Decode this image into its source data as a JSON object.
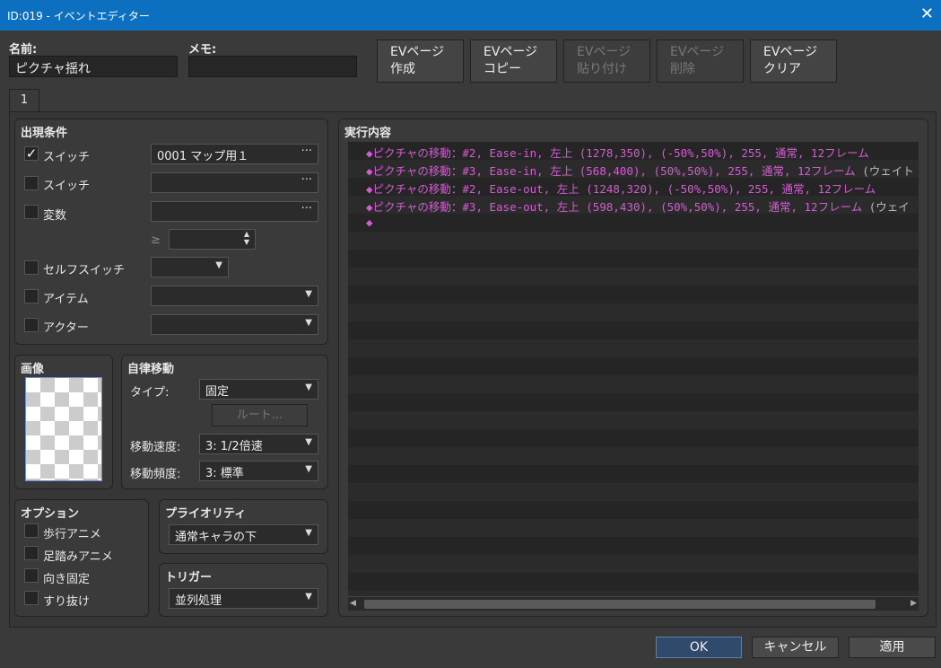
{
  "window": {
    "title": "ID:019 - イベントエディター",
    "close_icon": "close-icon"
  },
  "header": {
    "name_label": "名前:",
    "name_value": "ピクチャ揺れ",
    "memo_label": "メモ:",
    "memo_value": "",
    "buttons": [
      {
        "line1": "EVページ",
        "line2": "作成",
        "enabled": true
      },
      {
        "line1": "EVページ",
        "line2": "コピー",
        "enabled": true
      },
      {
        "line1": "EVページ",
        "line2": "貼り付け",
        "enabled": false
      },
      {
        "line1": "EVページ",
        "line2": "削除",
        "enabled": false
      },
      {
        "line1": "EVページ",
        "line2": "クリア",
        "enabled": true
      }
    ]
  },
  "tabs": [
    {
      "label": "1",
      "active": true
    }
  ],
  "conditions": {
    "title": "出現条件",
    "switch1_label": "スイッチ",
    "switch1_checked": true,
    "switch1_value": "0001 マップ用１",
    "switch2_label": "スイッチ",
    "switch2_checked": false,
    "switch2_value": "",
    "variable_label": "変数",
    "variable_checked": false,
    "variable_value": "",
    "variable_compare": "≥",
    "variable_number": "",
    "selfswitch_label": "セルフスイッチ",
    "selfswitch_checked": false,
    "selfswitch_value": "",
    "item_label": "アイテム",
    "item_checked": false,
    "item_value": "",
    "actor_label": "アクター",
    "actor_checked": false,
    "actor_value": ""
  },
  "image": {
    "title": "画像"
  },
  "autonomous": {
    "title": "自律移動",
    "type_label": "タイプ:",
    "type_value": "固定",
    "route_button": "ルート...",
    "speed_label": "移動速度:",
    "speed_value": "3: 1/2倍速",
    "freq_label": "移動頻度:",
    "freq_value": "3: 標準"
  },
  "options": {
    "title": "オプション",
    "items": [
      {
        "label": "歩行アニメ",
        "checked": false
      },
      {
        "label": "足踏みアニメ",
        "checked": false
      },
      {
        "label": "向き固定",
        "checked": false
      },
      {
        "label": "すり抜け",
        "checked": false
      }
    ]
  },
  "priority": {
    "title": "プライオリティ",
    "value": "通常キャラの下"
  },
  "trigger": {
    "title": "トリガー",
    "value": "並列処理"
  },
  "contents": {
    "title": "実行内容",
    "commands": [
      {
        "text": "◆ピクチャの移動：#2, Ease-in, 左上 (1278,350), (-50%,50%), 255, 通常, 12フレーム",
        "tail": ""
      },
      {
        "text": "◆ピクチャの移動：#3, Ease-in, 左上 (568,400), (50%,50%), 255, 通常, 12フレーム",
        "tail": " (ウェイト"
      },
      {
        "text": "◆ピクチャの移動：#2, Ease-out, 左上 (1248,320), (-50%,50%), 255, 通常, 12フレーム",
        "tail": ""
      },
      {
        "text": "◆ピクチャの移動：#3, Ease-out, 左上 (598,430), (50%,50%), 255, 通常, 12フレーム",
        "tail": " (ウェイ"
      },
      {
        "text": "◆",
        "tail": ""
      }
    ]
  },
  "footer": {
    "ok": "OK",
    "cancel": "キャンセル",
    "apply": "適用"
  },
  "colors": {
    "accent": "#0c6fc0",
    "command": "#d35cd3",
    "ok_button": "#2f4a6b"
  }
}
